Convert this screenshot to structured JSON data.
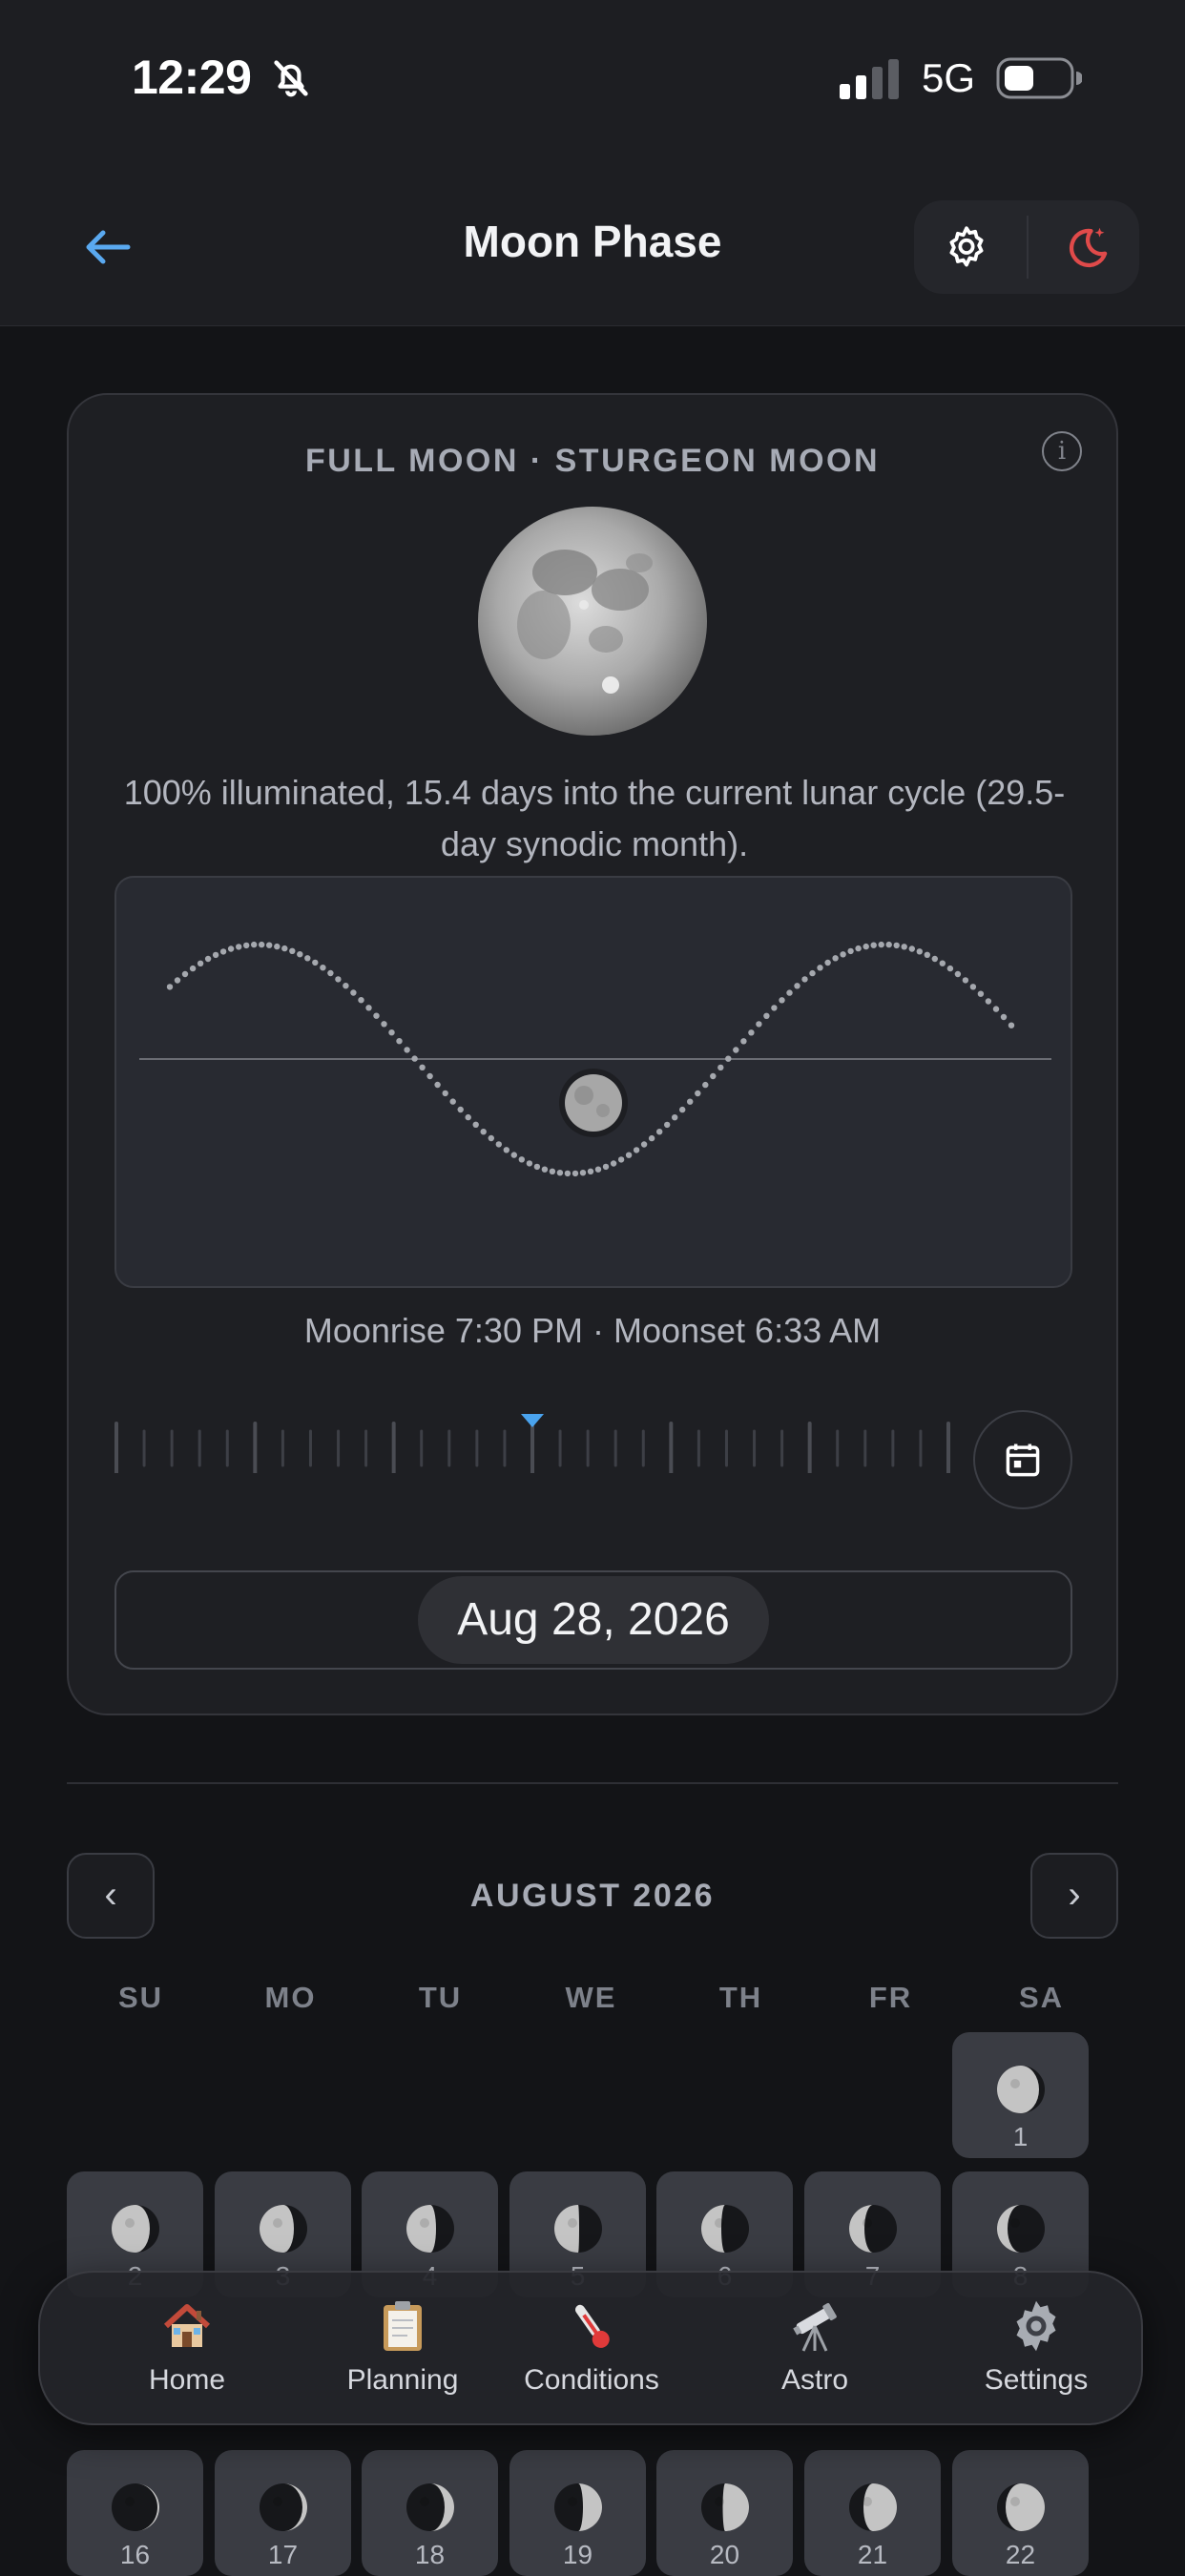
{
  "status_bar": {
    "time": "12:29",
    "network": "5G"
  },
  "header": {
    "title": "Moon Phase"
  },
  "card": {
    "phase_title": "FULL MOON · STURGEON MOON",
    "description": "100% illuminated, 15.4 days into the current lunar cycle (29.5-day synodic month).",
    "illumination_percent": 100,
    "cycle_day": 15.4,
    "moon_times": "Moonrise 7:30 PM · Moonset 6:33 AM",
    "date": "Aug 28, 2026"
  },
  "calendar": {
    "month": "AUGUST 2026",
    "prev_label": "‹",
    "next_label": "›",
    "weekdays": [
      "SU",
      "MO",
      "TU",
      "WE",
      "TH",
      "FR",
      "SA"
    ],
    "days": [
      {
        "day": "1",
        "illum": 0.88,
        "waxing": false
      },
      {
        "day": "2",
        "illum": 0.8,
        "waxing": false
      },
      {
        "day": "3",
        "illum": 0.72,
        "waxing": false
      },
      {
        "day": "4",
        "illum": 0.62,
        "waxing": false
      },
      {
        "day": "5",
        "illum": 0.52,
        "waxing": false
      },
      {
        "day": "6",
        "illum": 0.42,
        "waxing": false
      },
      {
        "day": "7",
        "illum": 0.32,
        "waxing": false
      },
      {
        "day": "8",
        "illum": 0.22,
        "waxing": false
      },
      {
        "day": "16",
        "illum": 0.04,
        "waxing": true
      },
      {
        "day": "17",
        "illum": 0.1,
        "waxing": true
      },
      {
        "day": "18",
        "illum": 0.2,
        "waxing": true
      },
      {
        "day": "19",
        "illum": 0.4,
        "waxing": true
      },
      {
        "day": "20",
        "illum": 0.55,
        "waxing": true
      },
      {
        "day": "21",
        "illum": 0.7,
        "waxing": true
      },
      {
        "day": "22",
        "illum": 0.82,
        "waxing": true
      }
    ]
  },
  "tabs": [
    {
      "label": "Home",
      "icon": "house-icon"
    },
    {
      "label": "Planning",
      "icon": "clipboard-icon"
    },
    {
      "label": "Conditions",
      "icon": "thermometer-icon"
    },
    {
      "label": "Astro",
      "icon": "telescope-icon"
    },
    {
      "label": "Settings",
      "icon": "gear-icon"
    }
  ],
  "colors": {
    "accent": "#5aa9f0",
    "night_mode": "#e04a4a",
    "background": "#131417"
  }
}
